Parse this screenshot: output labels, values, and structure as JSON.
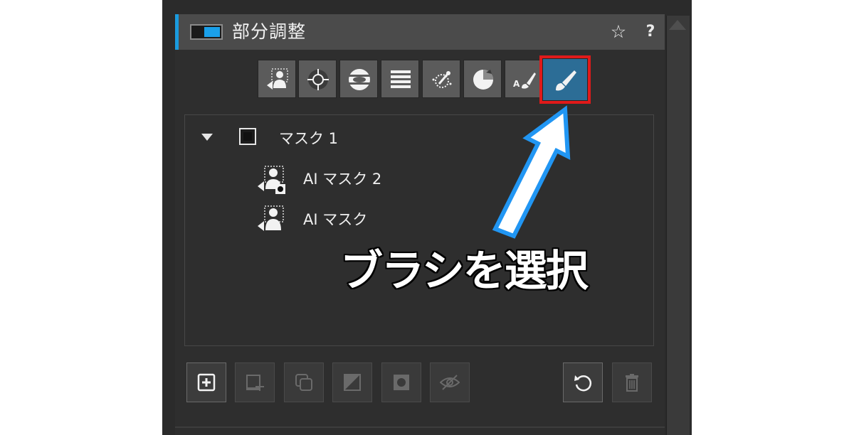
{
  "panel": {
    "title": "部分調整",
    "help_label": "?",
    "accent_color": "#1a9bde"
  },
  "toolbar": {
    "tools": [
      {
        "icon": "ai-mask-icon"
      },
      {
        "icon": "control-point-icon"
      },
      {
        "icon": "radial-gradient-icon"
      },
      {
        "icon": "linear-gradient-icon"
      },
      {
        "icon": "color-range-icon"
      },
      {
        "icon": "luminance-range-icon"
      },
      {
        "icon": "auto-brush-icon"
      },
      {
        "icon": "brush-icon",
        "selected": true
      }
    ],
    "selected_color": "#2c6d96",
    "highlight_color": "#e01a1a"
  },
  "mask_list": {
    "items": [
      {
        "label": "マスク 1",
        "level": 0,
        "expanded": true
      },
      {
        "label": "AI マスク 2",
        "level": 1,
        "icon": "ai-mask-subtract-icon"
      },
      {
        "label": "AI マスク",
        "level": 1,
        "icon": "ai-mask-icon"
      }
    ]
  },
  "bottom_toolbar": {
    "buttons": [
      {
        "icon": "add-mask-icon",
        "enabled": true
      },
      {
        "icon": "add-to-mask-icon",
        "enabled": false
      },
      {
        "icon": "duplicate-mask-icon",
        "enabled": false
      },
      {
        "icon": "invert-mask-icon",
        "enabled": false
      },
      {
        "icon": "mask-overlay-icon",
        "enabled": false
      },
      {
        "icon": "hide-mask-icon",
        "enabled": false
      },
      {
        "icon": "reset-icon",
        "enabled": true
      },
      {
        "icon": "delete-icon",
        "enabled": false
      }
    ]
  },
  "annotation": {
    "text": "ブラシを選択",
    "arrow_color": "#2196f3"
  }
}
